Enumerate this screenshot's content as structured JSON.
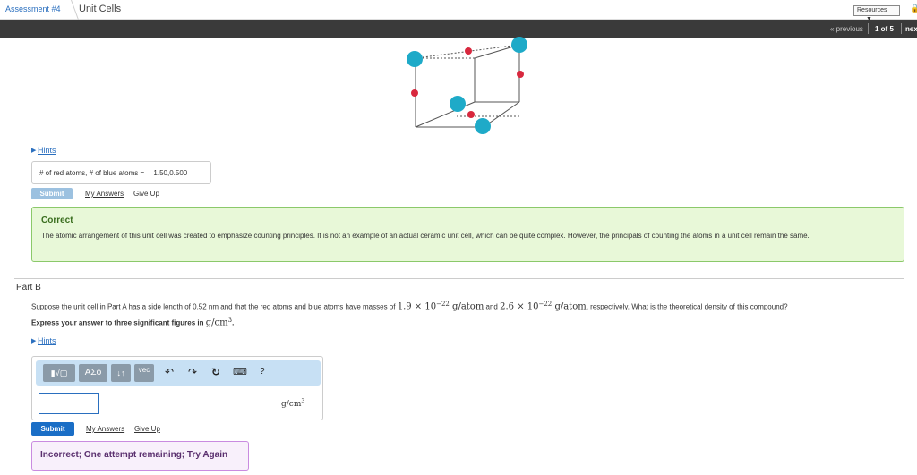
{
  "header": {
    "breadcrumb_link": "Assessment #4",
    "breadcrumb_current": "Unit Cells",
    "resources_label": "Resources",
    "resources_arrow": "▼"
  },
  "nav": {
    "previous": "« previous",
    "count": "1 of 5",
    "next": "next »"
  },
  "part_a": {
    "hints_label": "Hints",
    "answer_label": "# of red atoms, # of blue atoms =",
    "answer_value": "1.50,0.500",
    "submit_label": "Submit",
    "my_answers_label": "My Answers",
    "give_up_label": "Give Up",
    "feedback_title": "Correct",
    "feedback_text": "The atomic arrangement of this unit cell was created to emphasize counting principles. It is not an example of an actual ceramic unit cell, which can be quite complex. However, the principals of counting the atoms in a unit cell remain the same."
  },
  "part_b": {
    "title": "Part B",
    "question_1": "Suppose the unit cell in Part A has a side length of 0.52 nm and that the red atoms and blue atoms have masses of",
    "mass_red": "1.9 × 10",
    "exp_red": "−22",
    "unit_atom_1": " g/atom",
    "question_and": " and ",
    "mass_blue": "2.6 × 10",
    "exp_blue": "−22",
    "unit_atom_2": " g/atom",
    "question_2": ", respectively. What is the theoretical density of this compound?",
    "instruction": "Express your answer to three significant figures in",
    "instruction_unit": "g/cm",
    "instruction_exp": "3",
    "instruction_end": ".",
    "hints_label": "Hints",
    "toolbar": {
      "templates_label": "▮√▢",
      "greek_label": "ΑΣϕ",
      "arrows_label": "↓↑",
      "vec_label": "vec",
      "undo_glyph": "↶",
      "redo_glyph": "↷",
      "reset_glyph": "↻",
      "keyboard_glyph": "⌨",
      "help_glyph": "?"
    },
    "answer_value": "",
    "unit_label": "g/cm",
    "unit_exp": "3",
    "submit_label": "Submit",
    "my_answers_label": "My Answers",
    "give_up_label": "Give Up",
    "feedback_text": "Incorrect; One attempt remaining; Try Again"
  },
  "colors": {
    "blue_atom": "#1eaac8",
    "red_atom": "#d8283e",
    "correct_bg": "#e8f8d8",
    "incorrect_bg": "#f8f0fb",
    "link": "#2a6fbf"
  }
}
